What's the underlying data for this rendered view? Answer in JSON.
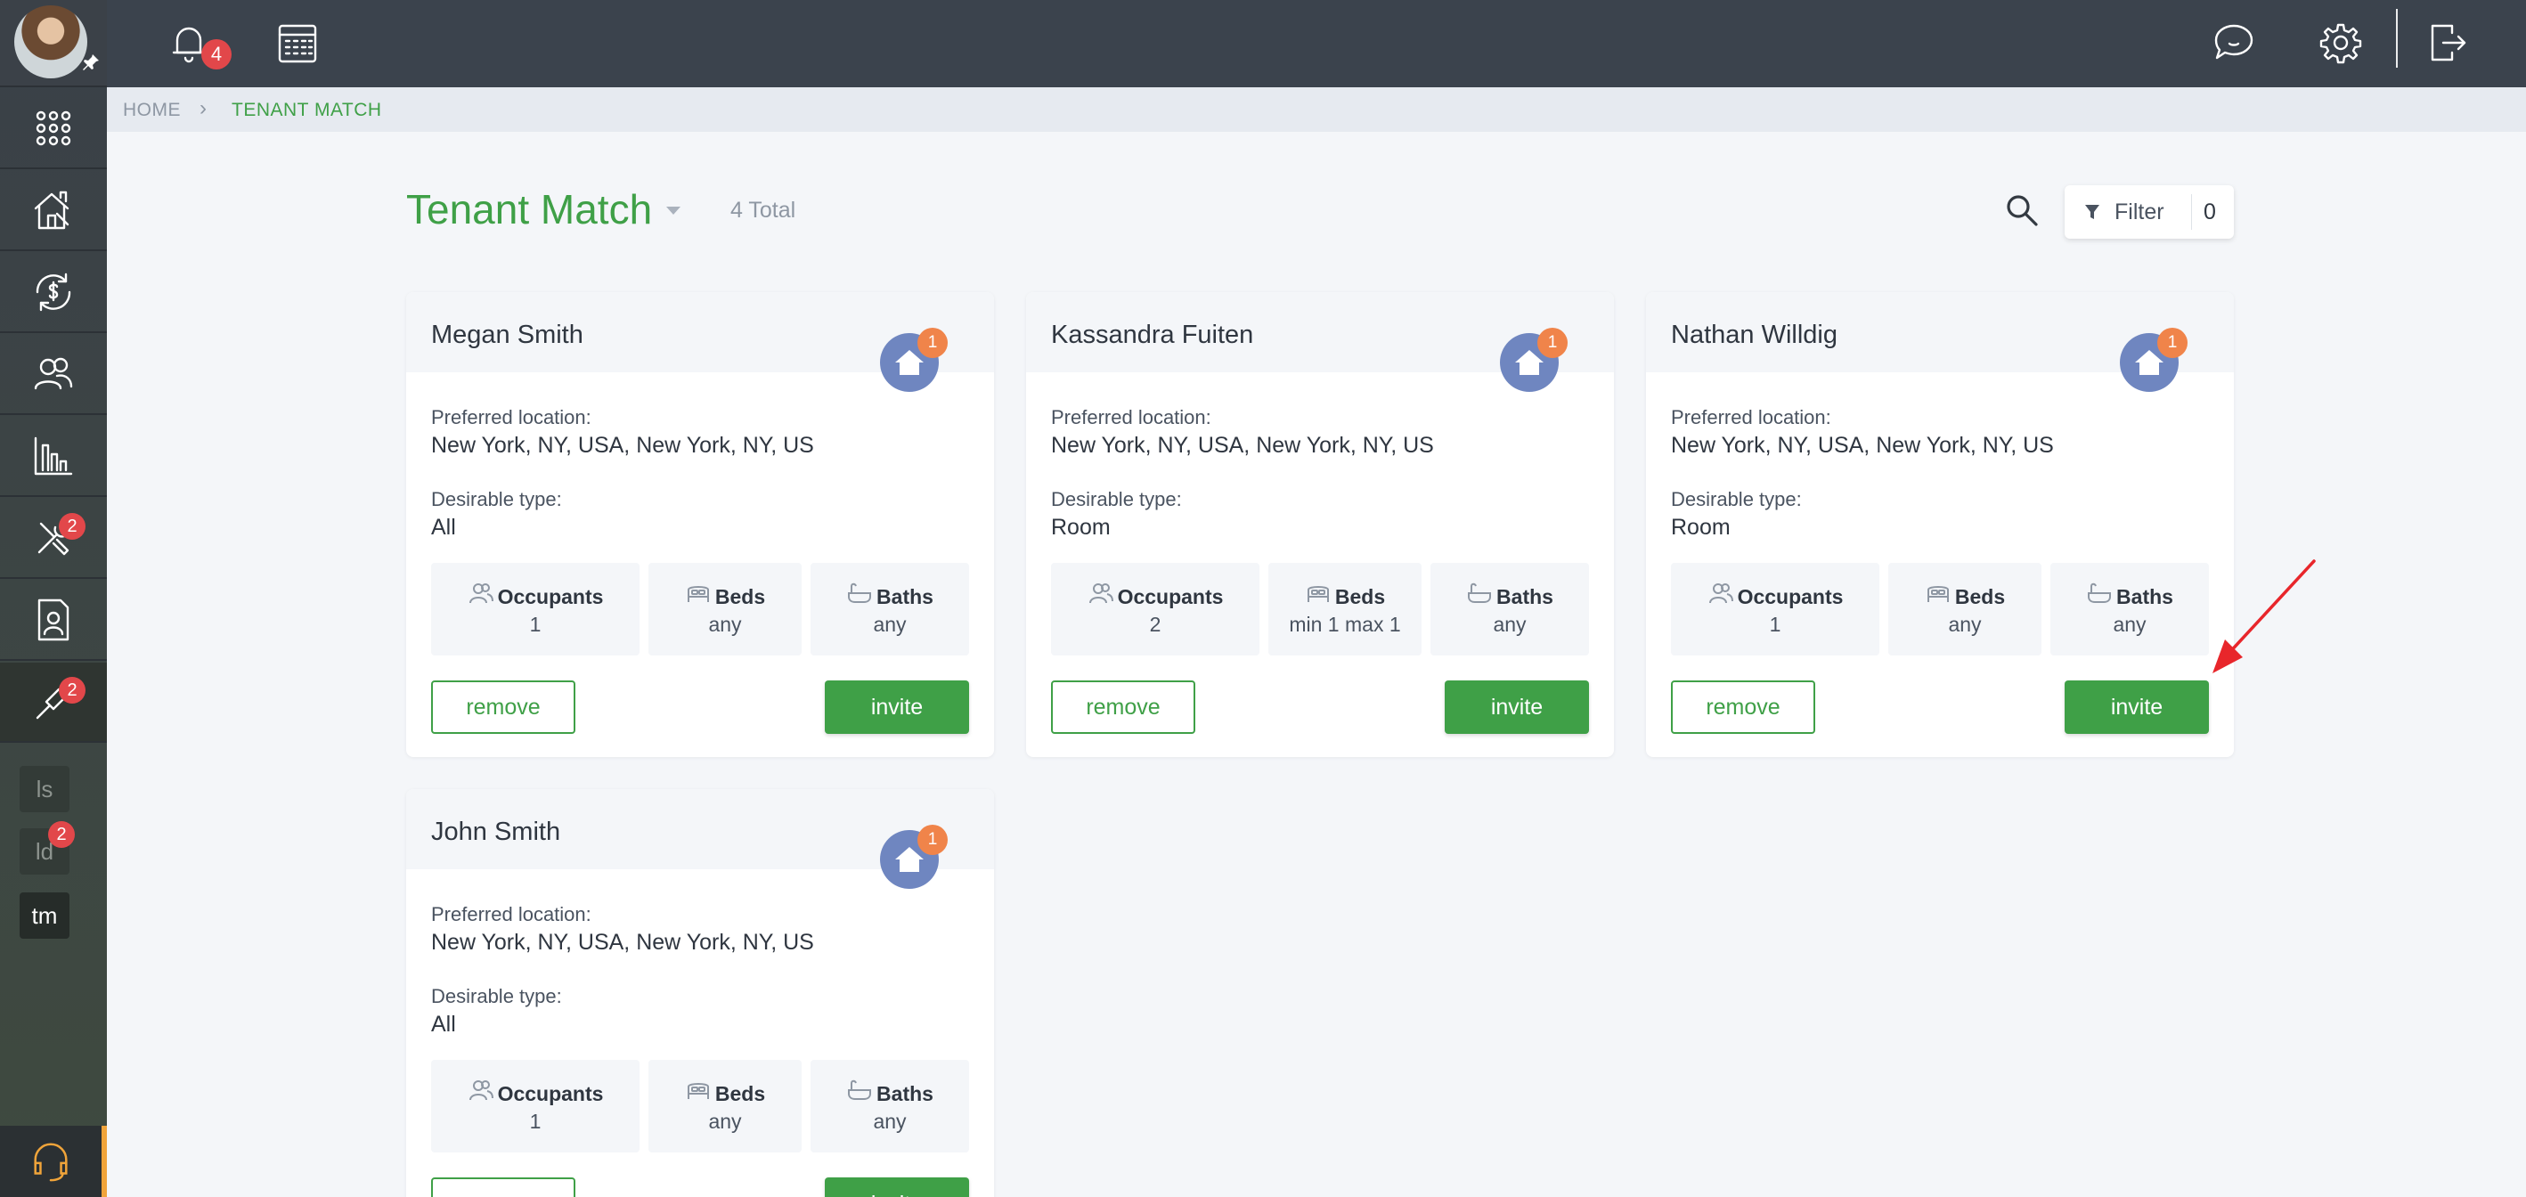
{
  "topbar": {
    "notification_count": "4",
    "icons": [
      "bell-icon",
      "calendar-icon",
      "chat-icon",
      "gear-icon",
      "logout-icon"
    ]
  },
  "sidebar": {
    "items": [
      {
        "icon": "apps-grid-icon"
      },
      {
        "icon": "properties-icon"
      },
      {
        "icon": "payments-icon"
      },
      {
        "icon": "tenants-icon"
      },
      {
        "icon": "reports-icon"
      },
      {
        "icon": "maintenance-icon",
        "badge": "2"
      },
      {
        "icon": "documents-icon"
      },
      {
        "icon": "tools-icon",
        "badge": "2",
        "active": true
      }
    ],
    "sub": [
      {
        "label": "ls"
      },
      {
        "label": "ld",
        "badge": "2"
      },
      {
        "label": "tm",
        "active": true
      }
    ]
  },
  "breadcrumb": {
    "home": "HOME",
    "separator": "›",
    "current": "TENANT MATCH"
  },
  "header": {
    "title": "Tenant Match",
    "total": "4 Total",
    "filter_label": "Filter",
    "filter_count": "0"
  },
  "labels": {
    "preferred_location": "Preferred location:",
    "desirable_type": "Desirable type:",
    "occupants": "Occupants",
    "beds": "Beds",
    "baths": "Baths",
    "remove": "remove",
    "invite": "invite"
  },
  "cards": [
    {
      "name": "Megan Smith",
      "badge": "1",
      "location": "New York, NY, USA, New York, NY, US",
      "type": "All",
      "occupants": "1",
      "beds": "any",
      "baths": "any"
    },
    {
      "name": "Kassandra Fuiten",
      "badge": "1",
      "location": "New York, NY, USA, New York, NY, US",
      "type": "Room",
      "occupants": "2",
      "beds": "min 1 max 1",
      "baths": "any"
    },
    {
      "name": "Nathan Willdig",
      "badge": "1",
      "location": "New York, NY, USA, New York, NY, US",
      "type": "Room",
      "occupants": "1",
      "beds": "any",
      "baths": "any"
    },
    {
      "name": "John Smith",
      "badge": "1",
      "location": "New York, NY, USA, New York, NY, US",
      "type": "All",
      "occupants": "1",
      "beds": "any",
      "baths": "any"
    }
  ],
  "colors": {
    "accent": "#3fa047",
    "topbar": "#3b434d",
    "badge": "#e2474a",
    "house": "#6f86c0",
    "house_badge": "#f0844a",
    "annotation_arrow": "#e8262b"
  }
}
